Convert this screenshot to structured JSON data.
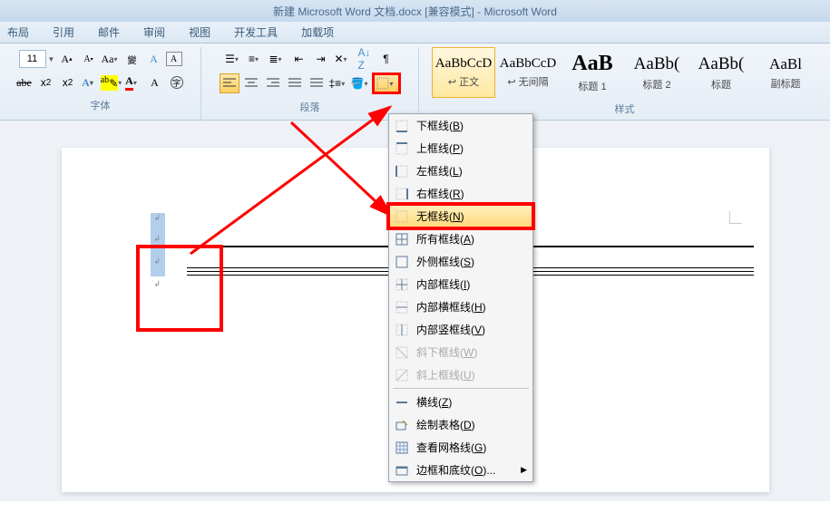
{
  "title": "新建 Microsoft Word 文档.docx [兼容模式] - Microsoft Word",
  "tabs": [
    "布局",
    "引用",
    "邮件",
    "审阅",
    "视图",
    "开发工具",
    "加载项"
  ],
  "font": {
    "size": "11",
    "section_label": "字体"
  },
  "paragraph": {
    "section_label": "段落"
  },
  "styles": {
    "section_label": "样式",
    "items": [
      {
        "preview": "AaBbCcD",
        "name": "↩ 正文",
        "selected": true,
        "size": "15px",
        "weight": "normal"
      },
      {
        "preview": "AaBbCcD",
        "name": "↩ 无间隔",
        "selected": false,
        "size": "15px",
        "weight": "normal"
      },
      {
        "preview": "AaB",
        "name": "标题 1",
        "selected": false,
        "size": "24px",
        "weight": "bold"
      },
      {
        "preview": "AaBb(",
        "name": "标题 2",
        "selected": false,
        "size": "19px",
        "weight": "normal"
      },
      {
        "preview": "AaBb(",
        "name": "标题",
        "selected": false,
        "size": "19px",
        "weight": "normal"
      },
      {
        "preview": "AaBl",
        "name": "副标题",
        "selected": false,
        "size": "17px",
        "weight": "normal"
      }
    ]
  },
  "border_menu": {
    "items": [
      {
        "label": "下框线",
        "key": "B",
        "icon": "bottom"
      },
      {
        "label": "上框线",
        "key": "P",
        "icon": "top"
      },
      {
        "label": "左框线",
        "key": "L",
        "icon": "left"
      },
      {
        "label": "右框线",
        "key": "R",
        "icon": "right"
      },
      {
        "label": "无框线",
        "key": "N",
        "icon": "none",
        "highlighted": true,
        "red_boxed": true
      },
      {
        "label": "所有框线",
        "key": "A",
        "icon": "all"
      },
      {
        "label": "外侧框线",
        "key": "S",
        "icon": "outside"
      },
      {
        "label": "内部框线",
        "key": "I",
        "icon": "inside"
      },
      {
        "label": "内部横框线",
        "key": "H",
        "icon": "inside-h"
      },
      {
        "label": "内部竖框线",
        "key": "V",
        "icon": "inside-v"
      },
      {
        "label": "斜下框线",
        "key": "W",
        "icon": "diag-down",
        "disabled": true
      },
      {
        "label": "斜上框线",
        "key": "U",
        "icon": "diag-up",
        "disabled": true
      }
    ],
    "footer_items": [
      {
        "label": "横线",
        "key": "Z",
        "icon": "hr"
      },
      {
        "label": "绘制表格",
        "key": "D",
        "icon": "draw"
      },
      {
        "label": "查看网格线",
        "key": "G",
        "icon": "grid"
      },
      {
        "label": "边框和底纹",
        "key": "O",
        "icon": "dialog"
      }
    ]
  }
}
